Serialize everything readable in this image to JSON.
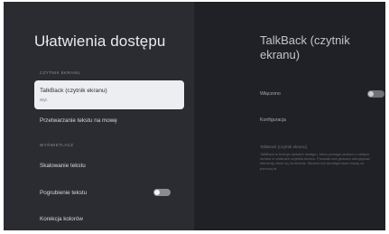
{
  "left": {
    "title": "Ułatwienia dostępu",
    "section_reader": "CZYTNIK EKRANU",
    "talkback_label": "TalkBack (czytnik ekranu)",
    "talkback_status": "Wył.",
    "tts_label": "Przetwarzanie tekstu na mowę",
    "section_display": "WYŚWIETLACZ",
    "text_scaling_label": "Skalowanie tekstu",
    "bold_text_label": "Pogrubienie tekstu",
    "color_correction_label": "Korekcja kolorów"
  },
  "right": {
    "title": "TalkBack (czytnik ekranu)",
    "enabled_label": "Włączono",
    "config_label": "Konfiguracja",
    "desc_title": "TalkBack (czytnik ekranu)",
    "desc_text": "TalkBack to funkcja ułatwień dostępu, która pomaga osobom o słabym wzroku w obsłudze czytnika ekranu. Pozwala ona głosowo odczytywać elementy, które są na ekranie. Możesz też skonfigurować mowę za pomocą ta"
  },
  "colors": {
    "background": "#1f2126",
    "panel": "#2a2c31",
    "selected_card": "#eceef1"
  },
  "icons": [
    "toggle-switch"
  ]
}
